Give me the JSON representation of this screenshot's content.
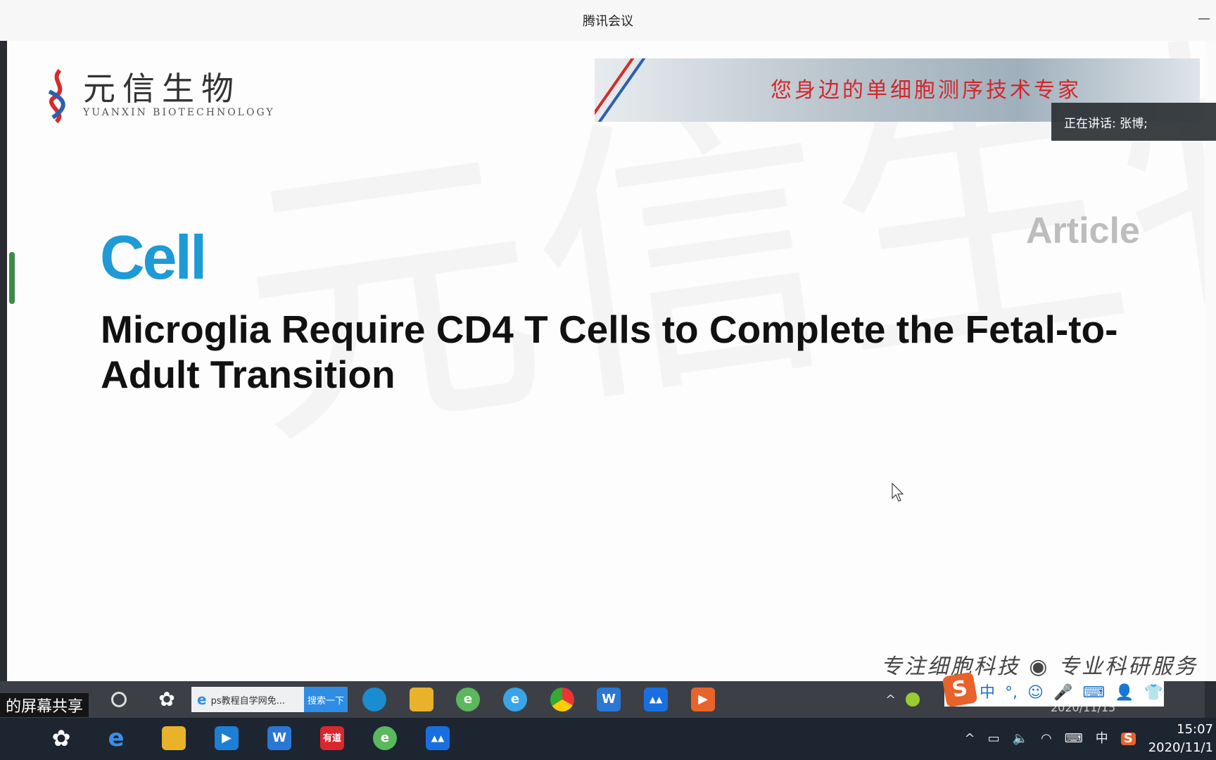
{
  "window": {
    "title": "腾讯会议",
    "minimize_label": "—"
  },
  "slide": {
    "logo_cn": "元信生物",
    "logo_en": "YUANXIN BIOTECHNOLOGY",
    "banner_text": "您身边的单细胞测序技术专家",
    "journal": "Cell",
    "article_type": "Article",
    "title": "Microglia Require CD4 T Cells to Complete the Fetal-to-Adult Transition",
    "watermark": "元信生物",
    "footer": "专注细胞科技 ◉ 专业科研服务",
    "colors": {
      "journal": "#1e9ad6",
      "banner_text": "#d3262b"
    }
  },
  "meeting": {
    "speaking": "正在讲话: 张博;",
    "share_label": "的屏幕共享"
  },
  "inner_taskbar": {
    "search_text": "ps教程自学网免...",
    "search_button": "搜索一下",
    "ime_items": [
      "中",
      "°,",
      "☺",
      "🎤",
      "⌨",
      "👤",
      "👕",
      "▦"
    ],
    "date": "2020/11/15"
  },
  "outer_taskbar": {
    "ime_mode": "中",
    "time": "15:07",
    "date": "2020/11/1"
  }
}
